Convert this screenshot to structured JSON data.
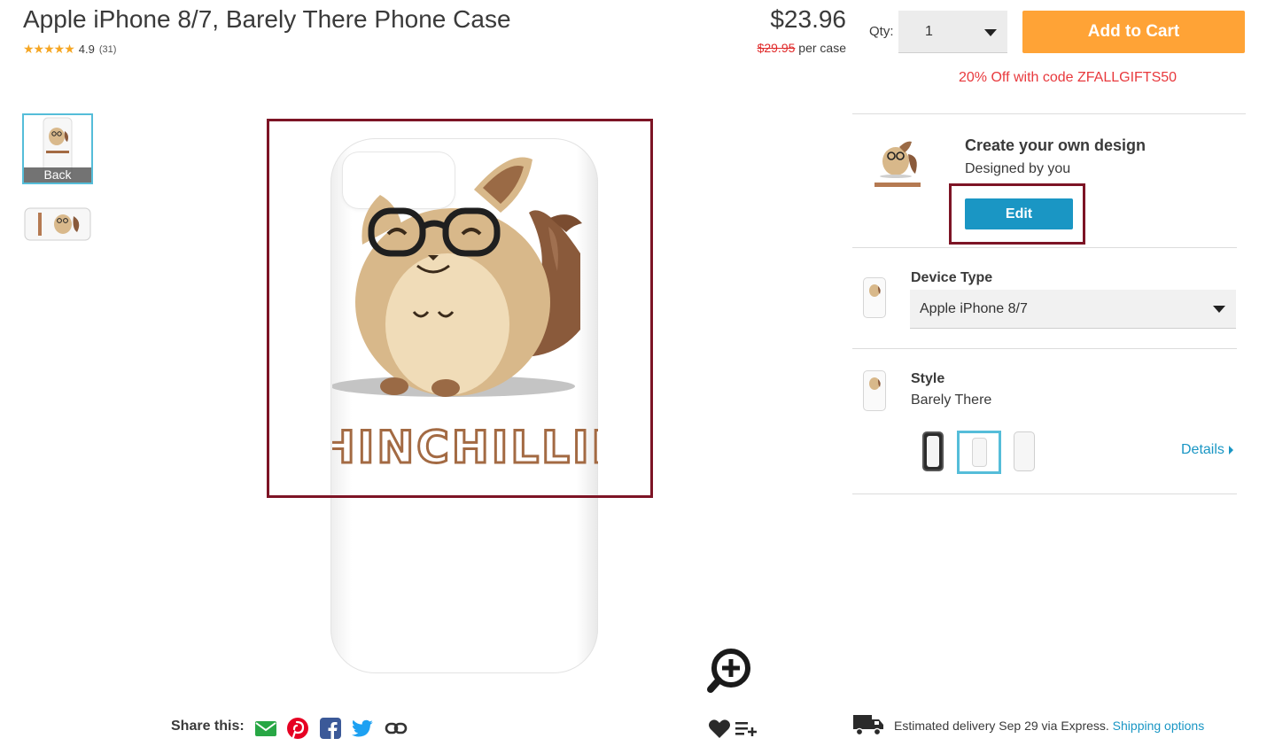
{
  "product": {
    "title": "Apple iPhone 8/7, Barely There Phone Case",
    "rating_stars": "★★★★★",
    "rating_value": "4.9",
    "rating_count": "(31)",
    "price": "$23.96",
    "original_price": "$29.95",
    "price_unit": "per case",
    "promo": "20% Off with code ZFALLGIFTS50"
  },
  "purchase": {
    "qty_label": "Qty:",
    "qty_value": "1",
    "add_to_cart": "Add to Cart"
  },
  "gallery": {
    "thumb_label": "Back",
    "case_text": "CHINCHILLIN'"
  },
  "design": {
    "title": "Create your own design",
    "subtitle": "Designed by you",
    "edit_label": "Edit"
  },
  "device": {
    "label": "Device Type",
    "value": "Apple iPhone 8/7"
  },
  "style": {
    "label": "Style",
    "value": "Barely There",
    "details_label": "Details"
  },
  "share": {
    "label": "Share this:",
    "icons": [
      "email-icon",
      "pinterest-icon",
      "facebook-icon",
      "twitter-icon",
      "link-icon"
    ]
  },
  "delivery": {
    "text": "Estimated delivery Sep 29 via Express.",
    "link": "Shipping options"
  },
  "colors": {
    "accent_orange": "#ffa336",
    "edit_blue": "#1a96c4",
    "promo_red": "#e8393d",
    "highlight": "#7d1425",
    "selected_border": "#55bdd9"
  }
}
